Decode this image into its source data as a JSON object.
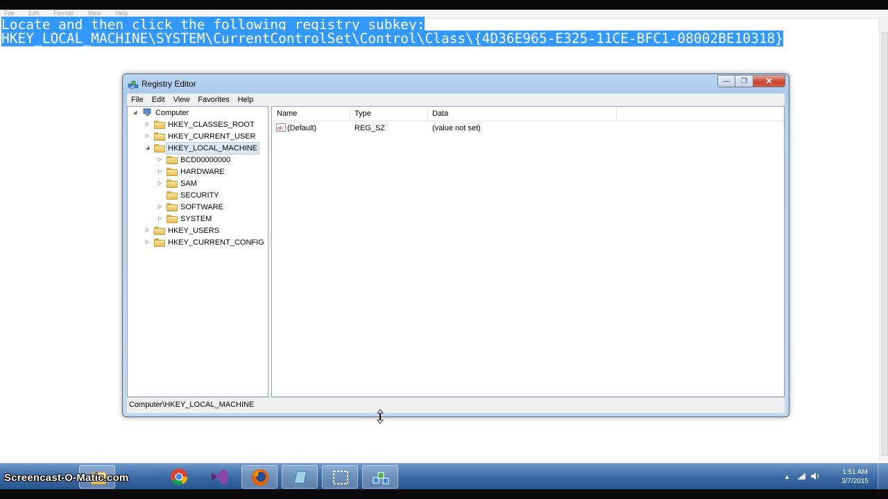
{
  "notepad": {
    "menu": [
      "File",
      "Edit",
      "Format",
      "View",
      "Help"
    ],
    "line1": "Locate and then click the following registry subkey:",
    "line2": "HKEY_LOCAL_MACHINE\\SYSTEM\\CurrentControlSet\\Control\\Class\\{4D36E965-E325-11CE-BFC1-08002BE10318}"
  },
  "regedit": {
    "title": "Registry Editor",
    "menu": [
      "File",
      "Edit",
      "View",
      "Favorites",
      "Help"
    ],
    "tree": {
      "root": "Computer",
      "hkcr": "HKEY_CLASSES_ROOT",
      "hkcu": "HKEY_CURRENT_USER",
      "hklm": "HKEY_LOCAL_MACHINE",
      "hklm_children": [
        "BCD00000000",
        "HARDWARE",
        "SAM",
        "SECURITY",
        "SOFTWARE",
        "SYSTEM"
      ],
      "hku": "HKEY_USERS",
      "hkcc": "HKEY_CURRENT_CONFIG"
    },
    "columns": {
      "name": "Name",
      "type": "Type",
      "data": "Data"
    },
    "row": {
      "name": "(Default)",
      "type": "REG_SZ",
      "data": "(value not set)"
    },
    "status": "Computer\\HKEY_LOCAL_MACHINE"
  },
  "taskbar": {
    "watermark": "Screencast-O-Matic.com",
    "time": "1:51 AM",
    "date": "3/7/2015"
  },
  "colors": {
    "selection": "#3399ff",
    "taskbar": "#3f6ea8",
    "close_button": "#c7412b"
  }
}
